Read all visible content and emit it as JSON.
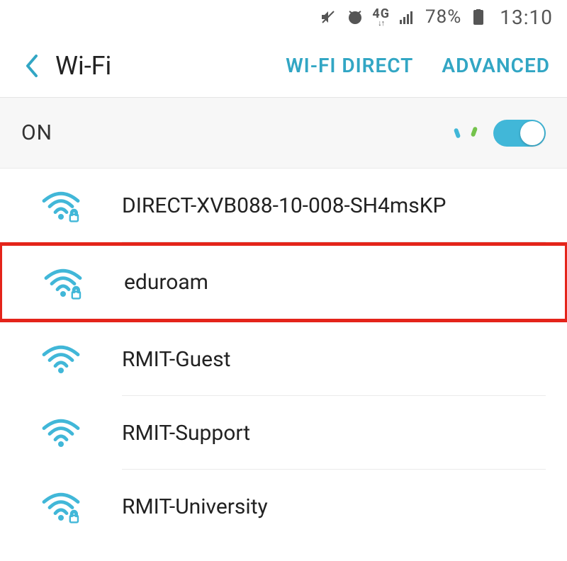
{
  "statusbar": {
    "network_label": "4G",
    "battery_percent": "78%",
    "time": "13:10"
  },
  "appbar": {
    "title": "Wi-Fi",
    "wifi_direct": "WI-FI DIRECT",
    "advanced": "ADVANCED"
  },
  "wifi": {
    "state_label": "ON",
    "enabled": true
  },
  "networks": [
    {
      "ssid": "DIRECT-XVB088-10-008-SH4msKP",
      "secured": true,
      "highlighted": false
    },
    {
      "ssid": "eduroam",
      "secured": true,
      "highlighted": true
    },
    {
      "ssid": "RMIT-Guest",
      "secured": false,
      "highlighted": false
    },
    {
      "ssid": "RMIT-Support",
      "secured": false,
      "highlighted": false
    },
    {
      "ssid": "RMIT-University",
      "secured": true,
      "highlighted": false
    }
  ]
}
